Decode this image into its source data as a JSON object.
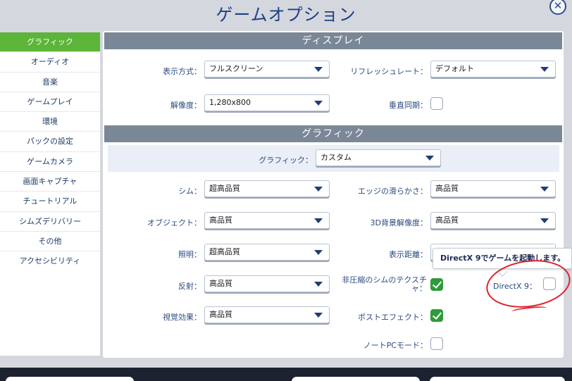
{
  "title": "ゲームオプション",
  "close_icon": "close-icon",
  "sidebar": {
    "items": [
      {
        "label": "グラフィック",
        "active": true
      },
      {
        "label": "オーディオ"
      },
      {
        "label": "音楽"
      },
      {
        "label": "ゲームプレイ"
      },
      {
        "label": "環境"
      },
      {
        "label": "パックの設定"
      },
      {
        "label": "ゲームカメラ"
      },
      {
        "label": "画面キャプチャ"
      },
      {
        "label": "チュートリアル"
      },
      {
        "label": "シムズデリバリー"
      },
      {
        "label": "その他"
      },
      {
        "label": "アクセシビリティ"
      }
    ]
  },
  "display": {
    "header": "ディスプレイ",
    "mode_label": "表示方式：",
    "mode_value": "フルスクリーン",
    "refresh_label": "リフレッシュレート：",
    "refresh_value": "デフォルト",
    "resolution_label": "解像度：",
    "resolution_value": "1,280x800",
    "vsync_label": "垂直同期：",
    "vsync_checked": false
  },
  "graphics": {
    "header": "グラフィック",
    "preset_label": "グラフィック：",
    "preset_value": "カスタム",
    "sim_label": "シム：",
    "sim_value": "超高品質",
    "edge_label": "エッジの滑らかさ：",
    "edge_value": "高品質",
    "object_label": "オブジェクト：",
    "object_value": "高品質",
    "bg3d_label": "3D背景解像度：",
    "bg3d_value": "高品質",
    "lighting_label": "照明：",
    "lighting_value": "超高品質",
    "distance_label": "表示距離：",
    "reflection_label": "反射：",
    "reflection_value": "高品質",
    "uncompressed_label": "非圧縮のシムのテクスチャ：",
    "uncompressed_checked": true,
    "directx_label": "DirectX 9：",
    "directx_checked": false,
    "visual_label": "視覚効果：",
    "visual_value": "高品質",
    "post_label": "ポストエフェクト：",
    "post_checked": true,
    "laptop_label": "ノートPCモード：",
    "laptop_checked": false
  },
  "tooltip": {
    "text": "DirectX 9でゲームを起動します。"
  },
  "colors": {
    "accent_green": "#5cb538",
    "header_gray": "#7a8796",
    "annotation_red": "#e0202a"
  }
}
